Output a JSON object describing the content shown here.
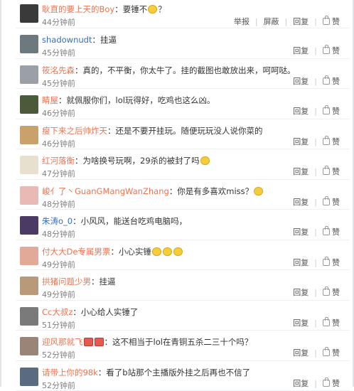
{
  "comments": [
    {
      "user": "耿直的要上天的Boy",
      "user_color": "orange",
      "text": "：要锤不",
      "emoji": [
        "yellow"
      ],
      "tail": "？",
      "time": "44分钟前",
      "avatar": "#3a3a3a",
      "actions": [
        "举报",
        "屏蔽",
        "回复",
        "赞"
      ]
    },
    {
      "user": "shadownudt",
      "user_color": "blue",
      "text": "：挂逼",
      "emoji": [],
      "tail": "",
      "time": "45分钟前",
      "avatar": "#6c7a80",
      "actions": [
        "回复",
        "赞"
      ]
    },
    {
      "user": "筱洺先森",
      "user_color": "orange",
      "text": "：真的，不平衡，你太牛了。挂的截图也敢放出来，呵呵哒。",
      "emoji": [],
      "tail": "",
      "time": "45分钟前",
      "avatar": "#9aa0a6",
      "actions": [
        "回复",
        "赞"
      ]
    },
    {
      "user": "睛屋",
      "user_color": "orange",
      "text": "：就佩服你们，lol玩得好，吃鸡也这么凶。",
      "emoji": [],
      "tail": "",
      "time": "46分钟前",
      "avatar": "#4a5a3a",
      "actions": [
        "回复",
        "赞"
      ]
    },
    {
      "user": "瘦下来之后帅炸天",
      "user_color": "orange",
      "text": "：还是不要开挂玩。随便玩玩没人说你菜的",
      "emoji": [],
      "tail": "",
      "time": "46分钟前",
      "avatar": "#c8a26a",
      "actions": [
        "回复",
        "赞"
      ]
    },
    {
      "user": "红河落衡",
      "user_color": "orange",
      "text": "：为啥换号玩啊，29杀的被封了吗",
      "emoji": [
        "yellow"
      ],
      "tail": "",
      "time": "47分钟前",
      "avatar": "#e8e0cf",
      "actions": [
        "回复",
        "赞"
      ]
    },
    {
      "user": "峻亻了丶GuanGMangWanZhang",
      "user_color": "orange",
      "text": "：你是有多喜欢miss？",
      "emoji": [
        "yellow"
      ],
      "tail": "",
      "time": "48分钟前",
      "avatar": "#e9b9b6",
      "actions": [
        "回复",
        "赞"
      ]
    },
    {
      "user": "朱涛o_0",
      "user_color": "blue",
      "text": "：小风风，能送台吃鸡电脑吗，",
      "emoji": [],
      "tail": "",
      "time": "48分钟前",
      "avatar": "#4b3a64",
      "actions": [
        "回复",
        "赞"
      ]
    },
    {
      "user": "付大大De专属男票",
      "user_color": "orange",
      "text": "：小心实锤",
      "emoji": [
        "yellow",
        "yellow",
        "yellow"
      ],
      "tail": "",
      "time": "49分钟前",
      "avatar": "#e2a898",
      "actions": [
        "回复",
        "赞"
      ]
    },
    {
      "user": "拱猪问题少男",
      "user_color": "orange",
      "text": "：挂逼",
      "emoji": [],
      "tail": "",
      "time": "49分钟前",
      "avatar": "#b89a7a",
      "actions": [
        "回复",
        "赞"
      ]
    },
    {
      "user": "Cc大叔z",
      "user_color": "orange",
      "text": "：小心给人实锤了",
      "emoji": [],
      "tail": "",
      "time": "51分钟前",
      "avatar": "#7a7a7a",
      "actions": [
        "回复",
        "赞"
      ]
    },
    {
      "user": "迎风那就飞",
      "user_color": "orange",
      "text": "：这不相当于lol在青铜五杀二三十个吗？",
      "emoji": [
        "red",
        "red"
      ],
      "tail": "",
      "emoji_after_name": true,
      "time": "52分钟前",
      "avatar": "#9a8478",
      "actions": [
        "回复",
        "赞"
      ]
    },
    {
      "user": "请带上你的98k",
      "user_color": "orange",
      "text": "：看了b站那个主播版外挂之后再也不信了",
      "emoji": [],
      "tail": "",
      "time": "52分钟前",
      "avatar": "#5a6a80",
      "actions": [
        "回复",
        "赞"
      ]
    }
  ]
}
